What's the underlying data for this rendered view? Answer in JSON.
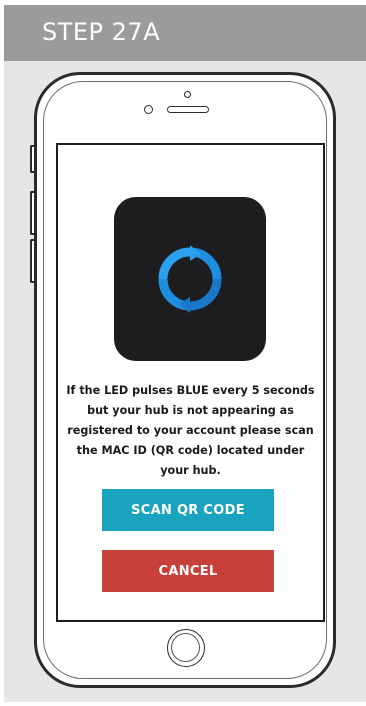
{
  "header": {
    "step_label": "STEP 27A"
  },
  "screen": {
    "app_icon": "sync-arrows-icon",
    "message": "If the LED pulses BLUE every 5 seconds but your hub is not appearing as registered to your account please scan the MAC ID (QR code) located under your hub.",
    "buttons": {
      "scan_label": "SCAN QR CODE",
      "cancel_label": "CANCEL"
    }
  },
  "colors": {
    "header_bg": "#9b9b9b",
    "frame_bg": "#e6e6e6",
    "icon_bg": "#1d1d1f",
    "icon_accent": "#1e8fe0",
    "scan_button": "#1aa3bf",
    "cancel_button": "#c8403a"
  }
}
